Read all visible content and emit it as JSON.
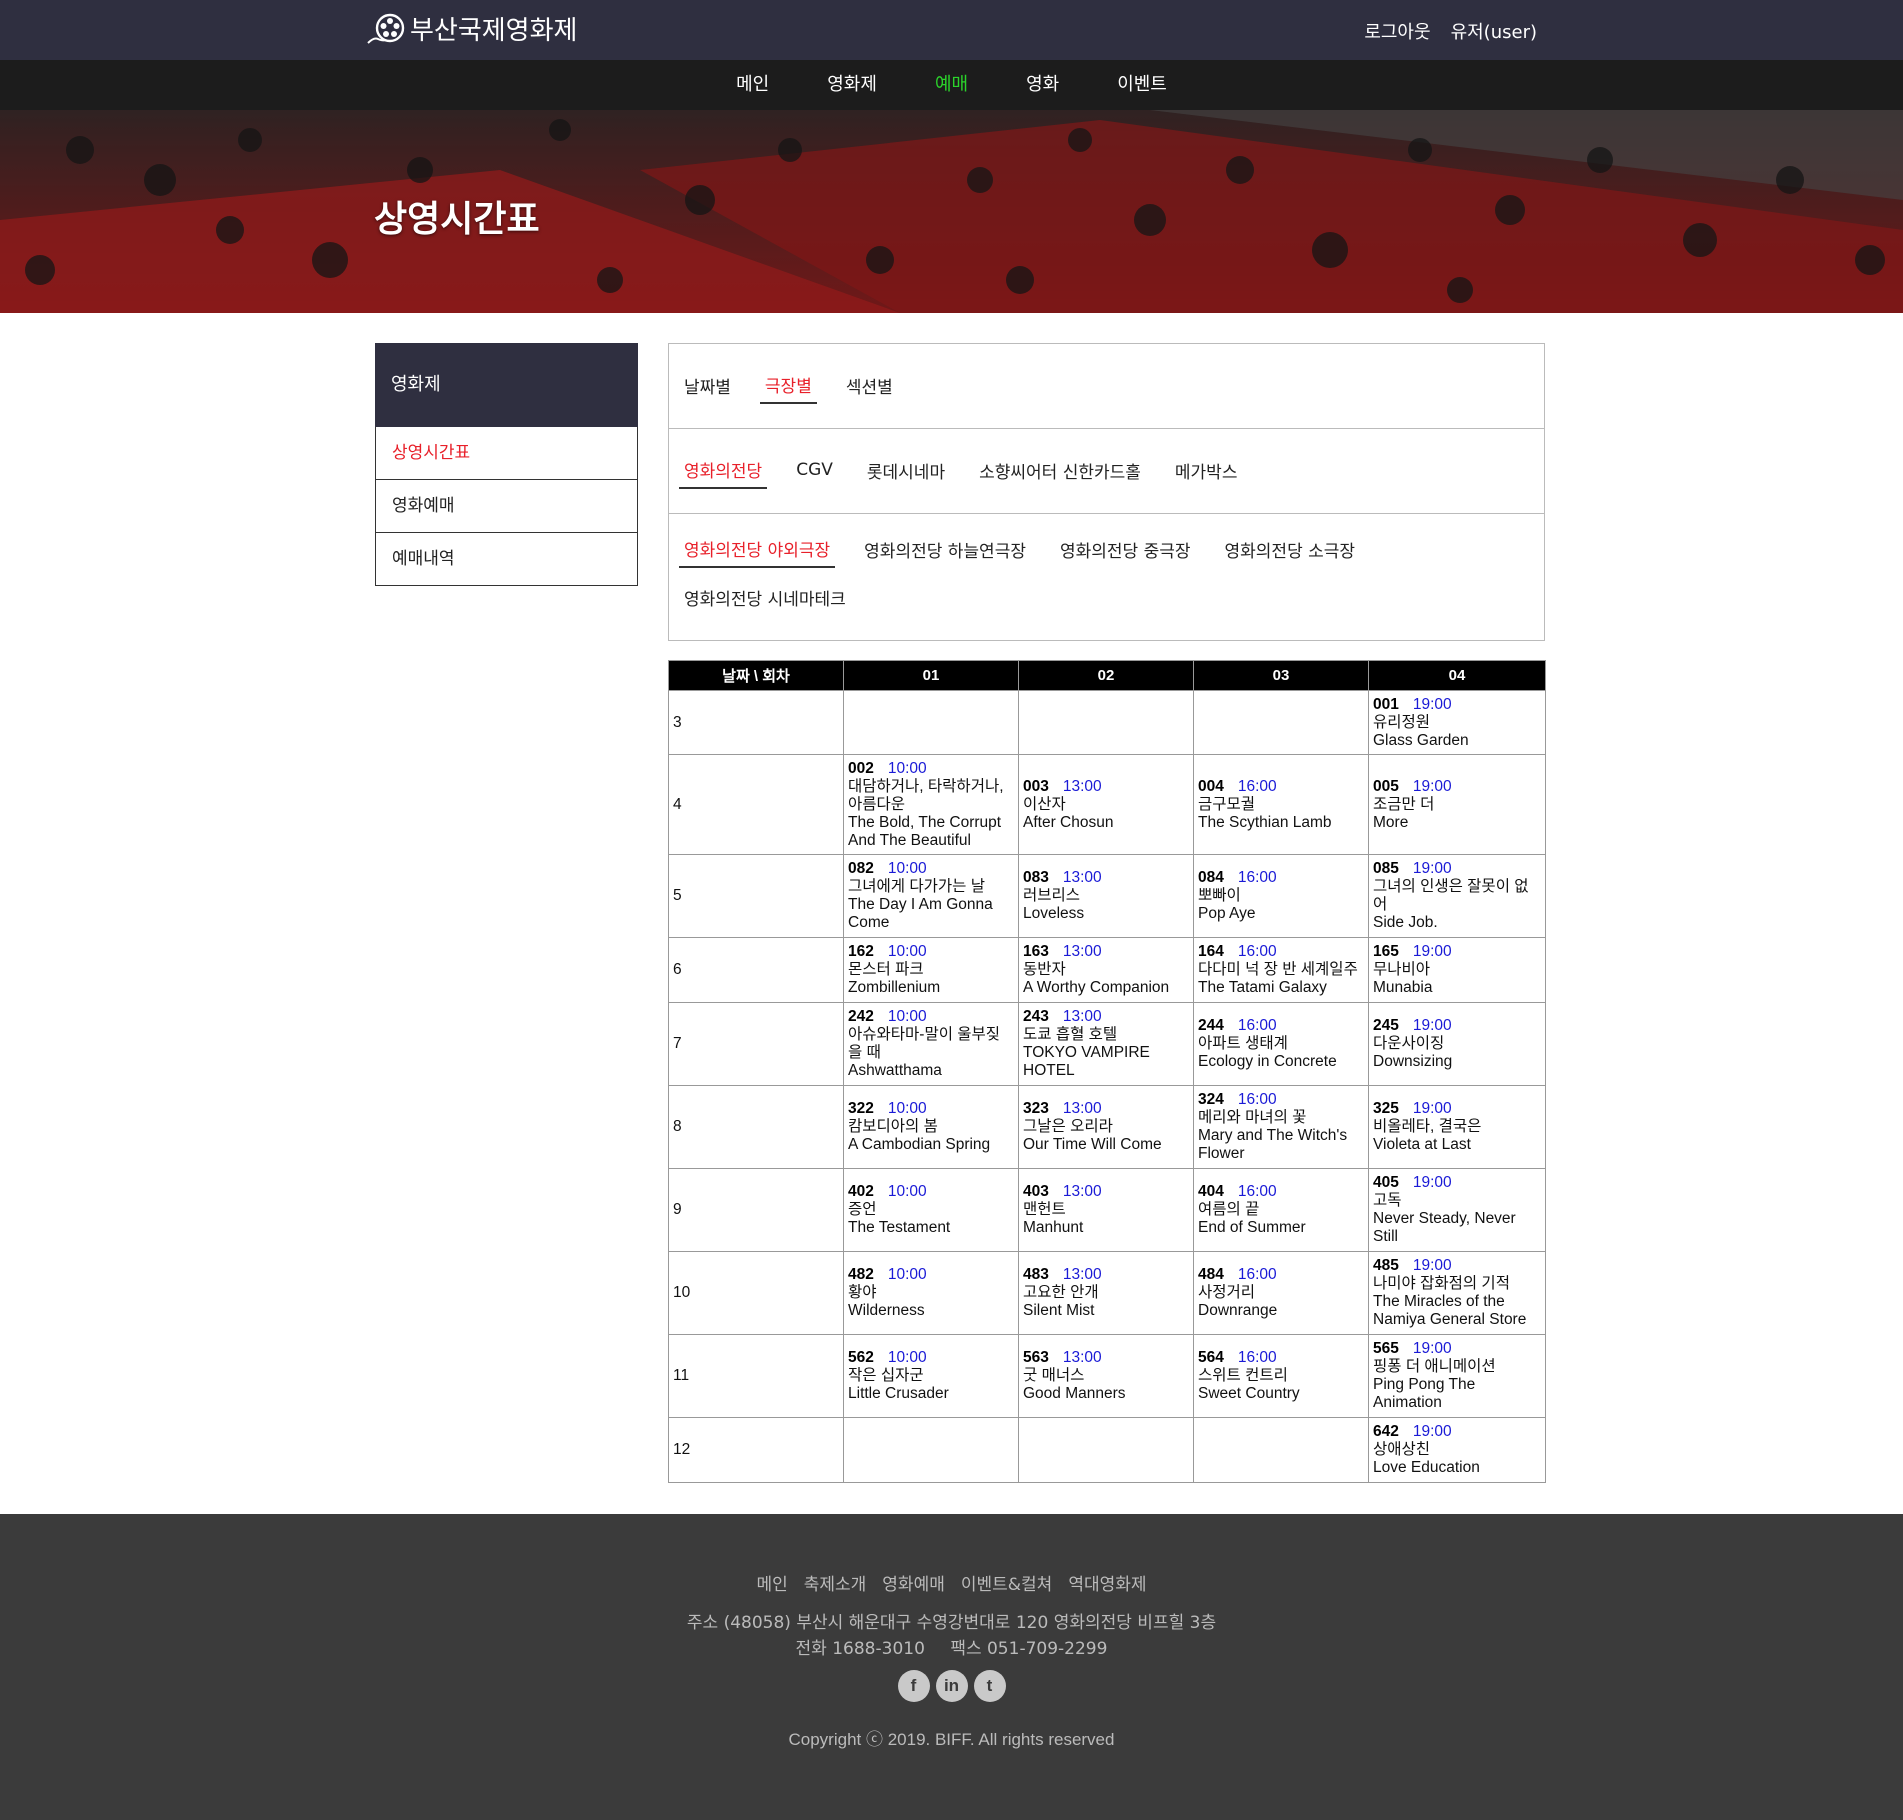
{
  "header": {
    "logo_text": "부산국제영화제",
    "logout": "로그아웃",
    "user": "유저(user)"
  },
  "nav": {
    "items": [
      {
        "label": "메인",
        "active": false
      },
      {
        "label": "영화제",
        "active": false
      },
      {
        "label": "예매",
        "active": true
      },
      {
        "label": "영화",
        "active": false
      },
      {
        "label": "이벤트",
        "active": false
      }
    ],
    "active_color": "#2bd32b"
  },
  "hero": {
    "title": "상영시간표"
  },
  "sidebar": {
    "title": "영화제",
    "items": [
      {
        "label": "상영시간표",
        "active": true
      },
      {
        "label": "영화예매",
        "active": false
      },
      {
        "label": "예매내역",
        "active": false
      }
    ]
  },
  "filters": {
    "modes": [
      {
        "label": "날짜별",
        "active": false
      },
      {
        "label": "극장별",
        "active": true
      },
      {
        "label": "섹션별",
        "active": false
      }
    ],
    "venues": [
      {
        "label": "영화의전당",
        "active": true
      },
      {
        "label": "CGV",
        "active": false
      },
      {
        "label": "롯데시네마",
        "active": false
      },
      {
        "label": "소향씨어터 신한카드홀",
        "active": false
      },
      {
        "label": "메가박스",
        "active": false
      }
    ],
    "halls": [
      {
        "label": "영화의전당 야외극장",
        "active": true
      },
      {
        "label": "영화의전당 하늘연극장",
        "active": false
      },
      {
        "label": "영화의전당 중극장",
        "active": false
      },
      {
        "label": "영화의전당 소극장",
        "active": false
      },
      {
        "label": "영화의전당 시네마테크",
        "active": false
      }
    ]
  },
  "schedule": {
    "headers": [
      "날짜 \\ 회차",
      "01",
      "02",
      "03",
      "04"
    ],
    "rows": [
      {
        "day": "3",
        "slots": [
          null,
          null,
          null,
          {
            "code": "001",
            "time": "19:00",
            "kr": "유리정원",
            "en": "Glass Garden"
          }
        ]
      },
      {
        "day": "4",
        "slots": [
          {
            "code": "002",
            "time": "10:00",
            "kr": "대담하거나, 타락하거나, 아름다운",
            "en": "The Bold, The Corrupt And The Beautiful"
          },
          {
            "code": "003",
            "time": "13:00",
            "kr": "이산자",
            "en": "After Chosun"
          },
          {
            "code": "004",
            "time": "16:00",
            "kr": "금구모궐",
            "en": "The Scythian Lamb"
          },
          {
            "code": "005",
            "time": "19:00",
            "kr": "조금만 더",
            "en": "More"
          }
        ]
      },
      {
        "day": "5",
        "slots": [
          {
            "code": "082",
            "time": "10:00",
            "kr": "그녀에게 다가가는 날",
            "en": "The Day I Am Gonna Come"
          },
          {
            "code": "083",
            "time": "13:00",
            "kr": "러브리스",
            "en": "Loveless"
          },
          {
            "code": "084",
            "time": "16:00",
            "kr": "뽀빠이",
            "en": "Pop Aye"
          },
          {
            "code": "085",
            "time": "19:00",
            "kr": "그녀의 인생은 잘못이 없어",
            "en": "Side Job."
          }
        ]
      },
      {
        "day": "6",
        "slots": [
          {
            "code": "162",
            "time": "10:00",
            "kr": "몬스터 파크",
            "en": "Zombillenium"
          },
          {
            "code": "163",
            "time": "13:00",
            "kr": "동반자",
            "en": "A Worthy Companion"
          },
          {
            "code": "164",
            "time": "16:00",
            "kr": "다다미 넉 장 반 세계일주",
            "en": "The Tatami Galaxy"
          },
          {
            "code": "165",
            "time": "19:00",
            "kr": "무나비아",
            "en": "Munabia"
          }
        ]
      },
      {
        "day": "7",
        "slots": [
          {
            "code": "242",
            "time": "10:00",
            "kr": "아슈와타마-말이 울부짖을 때",
            "en": "Ashwatthama"
          },
          {
            "code": "243",
            "time": "13:00",
            "kr": "도쿄 흡혈 호텔",
            "en": "TOKYO VAMPIRE HOTEL"
          },
          {
            "code": "244",
            "time": "16:00",
            "kr": "아파트 생태계",
            "en": "Ecology in Concrete"
          },
          {
            "code": "245",
            "time": "19:00",
            "kr": "다운사이징",
            "en": "Downsizing"
          }
        ]
      },
      {
        "day": "8",
        "slots": [
          {
            "code": "322",
            "time": "10:00",
            "kr": "캄보디아의 봄",
            "en": "A Cambodian Spring"
          },
          {
            "code": "323",
            "time": "13:00",
            "kr": "그날은 오리라",
            "en": "Our Time Will Come"
          },
          {
            "code": "324",
            "time": "16:00",
            "kr": "메리와 마녀의 꽃",
            "en": "Mary and The Witch's Flower"
          },
          {
            "code": "325",
            "time": "19:00",
            "kr": "비올레타, 결국은",
            "en": "Violeta at Last"
          }
        ]
      },
      {
        "day": "9",
        "slots": [
          {
            "code": "402",
            "time": "10:00",
            "kr": "증언",
            "en": "The Testament"
          },
          {
            "code": "403",
            "time": "13:00",
            "kr": "맨헌트",
            "en": "Manhunt"
          },
          {
            "code": "404",
            "time": "16:00",
            "kr": "여름의 끝",
            "en": "End of Summer"
          },
          {
            "code": "405",
            "time": "19:00",
            "kr": "고독",
            "en": "Never Steady, Never Still"
          }
        ]
      },
      {
        "day": "10",
        "slots": [
          {
            "code": "482",
            "time": "10:00",
            "kr": "황야",
            "en": "Wilderness"
          },
          {
            "code": "483",
            "time": "13:00",
            "kr": "고요한 안개",
            "en": "Silent Mist"
          },
          {
            "code": "484",
            "time": "16:00",
            "kr": "사정거리",
            "en": "Downrange"
          },
          {
            "code": "485",
            "time": "19:00",
            "kr": "나미야 잡화점의 기적",
            "en": "The Miracles of the Namiya General Store"
          }
        ]
      },
      {
        "day": "11",
        "slots": [
          {
            "code": "562",
            "time": "10:00",
            "kr": "작은 십자군",
            "en": "Little Crusader"
          },
          {
            "code": "563",
            "time": "13:00",
            "kr": "굿 매너스",
            "en": "Good Manners"
          },
          {
            "code": "564",
            "time": "16:00",
            "kr": "스위트 컨트리",
            "en": "Sweet Country"
          },
          {
            "code": "565",
            "time": "19:00",
            "kr": "핑퐁 더 애니메이션",
            "en": "Ping Pong The Animation"
          }
        ]
      },
      {
        "day": "12",
        "slots": [
          null,
          null,
          null,
          {
            "code": "642",
            "time": "19:00",
            "kr": "상애상친",
            "en": "Love Education"
          }
        ]
      }
    ],
    "row_heights": [
      64,
      100,
      83,
      65,
      83,
      83,
      83,
      83,
      83,
      65
    ]
  },
  "footer": {
    "links": [
      "메인",
      "축제소개",
      "영화예매",
      "이벤트&컬쳐",
      "역대영화제"
    ],
    "address": "주소 (48058) 부산시 해운대구 수영강변대로 120 영화의전당 비프힐 3층",
    "phone": "전화 1688-3010",
    "fax": "팩스 051-709-2299",
    "social": [
      {
        "icon": "facebook-icon",
        "glyph": "f"
      },
      {
        "icon": "linkedin-icon",
        "glyph": "in"
      },
      {
        "icon": "twitter-icon",
        "glyph": "t"
      }
    ],
    "copyright": "Copyright ⓒ 2019. BIFF. All rights reserved"
  }
}
